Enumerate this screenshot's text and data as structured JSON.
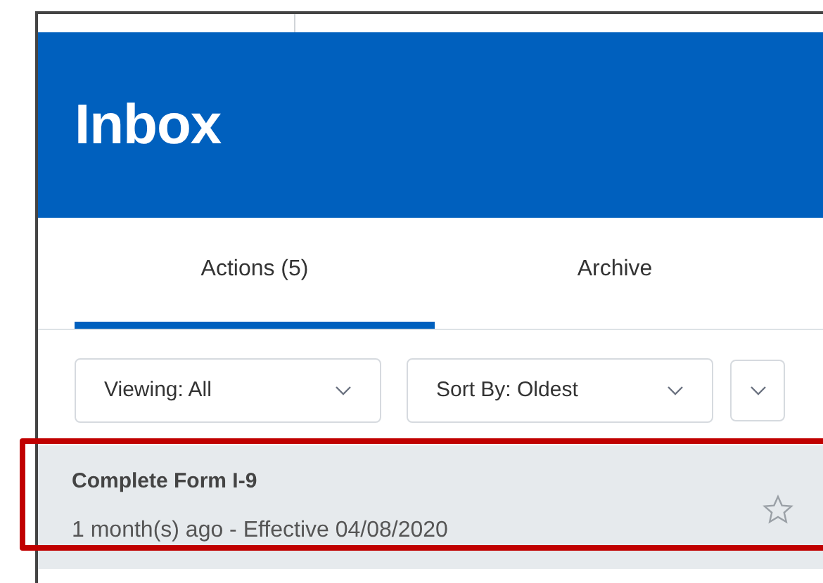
{
  "header": {
    "title": "Inbox"
  },
  "tabs": [
    {
      "label": "Actions (5)",
      "selected": true
    },
    {
      "label": "Archive",
      "selected": false
    }
  ],
  "filters": [
    {
      "label": "Viewing: All"
    },
    {
      "label": "Sort By: Oldest"
    }
  ],
  "items": [
    {
      "title": "Complete Form I-9",
      "subtitle": "1 month(s) ago - Effective 04/08/2020",
      "starred": false,
      "highlighted": true
    }
  ]
}
